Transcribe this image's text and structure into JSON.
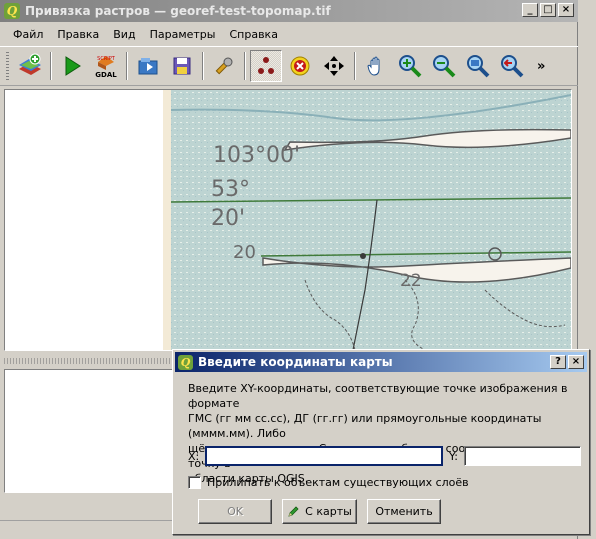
{
  "window": {
    "title": "Привязка растров — georef-test-topomap.tif",
    "controls": [
      "_",
      "□",
      "×"
    ]
  },
  "menu": [
    "Файл",
    "Правка",
    "Вид",
    "Параметры",
    "Справка"
  ],
  "toolbar": {
    "overflow": "»",
    "icons": [
      "open-raster-icon",
      "start-georef-icon",
      "generate-gdal-script-icon",
      "load-gcp-icon",
      "save-gcp-icon",
      "settings-icon",
      "add-point-icon",
      "delete-point-icon",
      "move-point-icon",
      "pan-icon",
      "zoom-in-icon",
      "zoom-out-icon",
      "zoom-to-layer-icon",
      "zoom-last-icon"
    ],
    "gdal_badge": "GDAL",
    "gdal_badge_top": "SCRIPT"
  },
  "map": {
    "labels": [
      "103°00'",
      "53°",
      "20'",
      "20",
      "22"
    ]
  },
  "dialog": {
    "title": "Введите координаты карты",
    "help": "?",
    "close": "×",
    "description_lines": [
      "Введите XY-координаты, соответствующие точке изображения в формате",
      "ГМС (гг мм сс.сс), ДГ (гг.гг) или прямоугольные координаты (мммм.мм). Либо",
      "щёлкните на кнопке «С карты» и выберите соответствующую точку в",
      "области карты QGIS."
    ],
    "x_label": "X:",
    "y_label": "Y:",
    "x_value": "",
    "y_value": "",
    "snap_label": "Прилипать к объектам существующих слоёв",
    "snap_checked": false,
    "ok_label": "OK",
    "from_canvas_label": "С карты",
    "cancel_label": "Отменить"
  }
}
